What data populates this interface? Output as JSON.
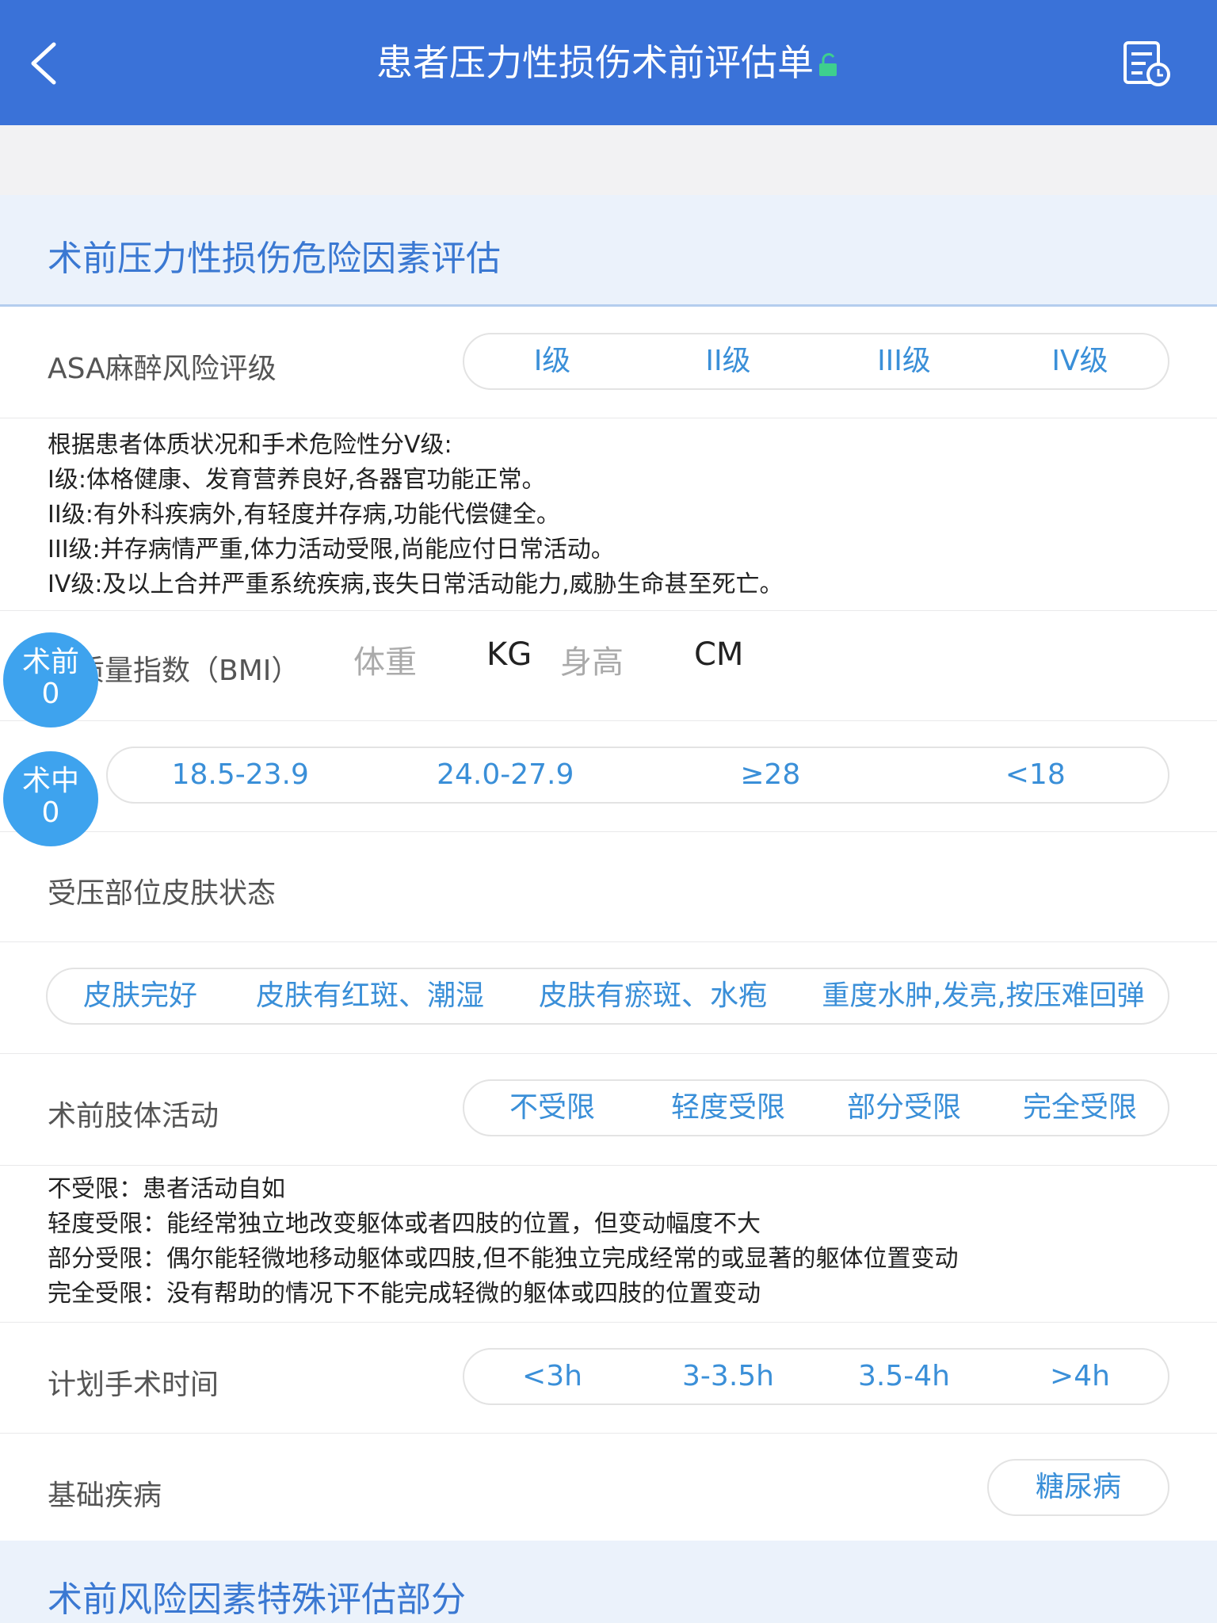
{
  "header": {
    "title": "患者压力性损伤术前评估单",
    "back_icon": "chevron-left-icon",
    "lock_icon": "unlock-icon",
    "history_icon": "document-clock-icon"
  },
  "sections": {
    "risk_factor_title": "术前压力性损伤危险因素评估",
    "special_title": "术前风险因素特殊评估部分"
  },
  "asa": {
    "label": "ASA麻醉风险评级",
    "options": [
      "I级",
      "II级",
      "III级",
      "IV级"
    ],
    "description": [
      "根据患者体质状况和手术危险性分V级:",
      "I级:体格健康、发育营养良好,各器官功能正常。",
      "II级:有外科疾病外,有轻度并存病,功能代偿健全。",
      "III级:并存病情严重,体力活动受限,尚能应付日常活动。",
      "IV级:及以上合并严重系统疾病,丧失日常活动能力,威胁生命甚至死亡。"
    ]
  },
  "bmi": {
    "label": "体质量指数（BMI）",
    "weight_placeholder": "体重",
    "weight_unit": "KG",
    "height_placeholder": "身高",
    "height_unit": "CM",
    "options": [
      "18.5-23.9",
      "24.0-27.9",
      "≥28",
      "<18"
    ]
  },
  "score_bubbles": [
    {
      "label": "术前",
      "value": "0"
    },
    {
      "label": "术中",
      "value": "0"
    }
  ],
  "skin": {
    "label": "受压部位皮肤状态",
    "options": [
      "皮肤完好",
      "皮肤有红斑、潮湿",
      "皮肤有瘀斑、水疱",
      "重度水肿,发亮,按压难回弹"
    ]
  },
  "limb": {
    "label": "术前肢体活动",
    "options": [
      "不受限",
      "轻度受限",
      "部分受限",
      "完全受限"
    ],
    "description": [
      "不受限：患者活动自如",
      "轻度受限：能经常独立地改变躯体或者四肢的位置，但变动幅度不大",
      "部分受限：偶尔能轻微地移动躯体或四肢,但不能独立完成经常的或显著的躯体位置变动",
      "完全受限：没有帮助的情况下不能完成轻微的躯体或四肢的位置变动"
    ]
  },
  "surgery_time": {
    "label": "计划手术时间",
    "options": [
      "<3h",
      "3-3.5h",
      "3.5-4h",
      ">4h"
    ]
  },
  "disease": {
    "label": "基础疾病",
    "option": "糖尿病"
  },
  "colors": {
    "header_bg": "#3a72d8",
    "accent": "#3a8fd8",
    "section_bg": "#ebf2fb",
    "bubble": "#3ea3ee",
    "lock": "#3ecf8e"
  }
}
